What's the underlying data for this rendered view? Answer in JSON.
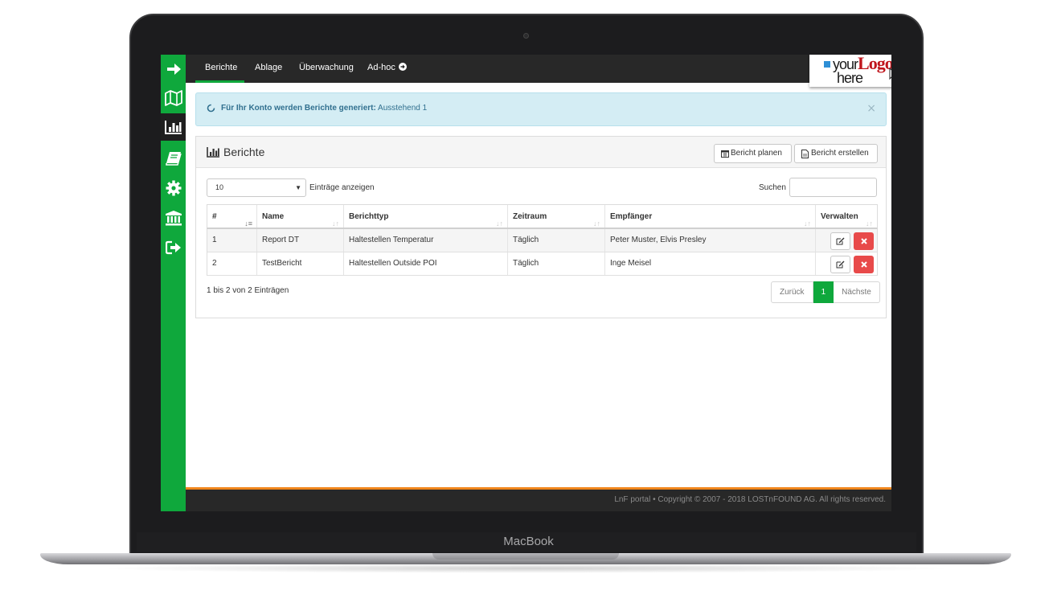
{
  "device": {
    "brand_label": "MacBook"
  },
  "nav": {
    "tabs": [
      {
        "label": "Berichte"
      },
      {
        "label": "Ablage"
      },
      {
        "label": "Überwachung"
      },
      {
        "label": "Ad-hoc"
      }
    ],
    "active_tab": "Berichte"
  },
  "sidebar": {
    "items": [
      {
        "icon": "arrow-right-icon"
      },
      {
        "icon": "map-icon"
      },
      {
        "icon": "bar-chart-icon",
        "active": true
      },
      {
        "icon": "book-icon"
      },
      {
        "icon": "gear-icon"
      },
      {
        "icon": "bank-icon"
      },
      {
        "icon": "sign-out-icon"
      }
    ]
  },
  "logo": {
    "line1_small": "your",
    "line1_big": "Logo",
    "line2": "here"
  },
  "alert": {
    "bold_text": "Für Ihr Konto werden Berichte generiert:",
    "text": "Ausstehend 1",
    "close": "×"
  },
  "panel": {
    "title": "Berichte",
    "btn_plan": "Bericht planen",
    "btn_create": "Bericht erstellen"
  },
  "controls": {
    "page_size": "10",
    "page_size_label": "Einträge anzeigen",
    "search_label": "Suchen"
  },
  "table": {
    "headers": [
      "#",
      "Name",
      "Berichttyp",
      "Zeitraum",
      "Empfänger",
      "Verwalten"
    ],
    "rows": [
      {
        "num": "1",
        "name": "Report DT",
        "type": "Haltestellen Temperatur",
        "period": "Täglich",
        "recipients": "Peter Muster, Elvis Presley"
      },
      {
        "num": "2",
        "name": "TestBericht",
        "type": "Haltestellen Outside POI",
        "period": "Täglich",
        "recipients": "Inge Meisel"
      }
    ]
  },
  "pagination": {
    "info": "1 bis 2 von 2 Einträgen",
    "prev": "Zurück",
    "current": "1",
    "next": "Nächste"
  },
  "footer": {
    "text": "LnF portal • Copyright © 2007 - 2018 LOSTnFOUND AG. All rights reserved."
  },
  "colors": {
    "primary": "#0fa83c",
    "dark": "#282828",
    "accent": "#f0861c",
    "danger": "#e84a4a",
    "info_bg": "#d4edf4"
  }
}
